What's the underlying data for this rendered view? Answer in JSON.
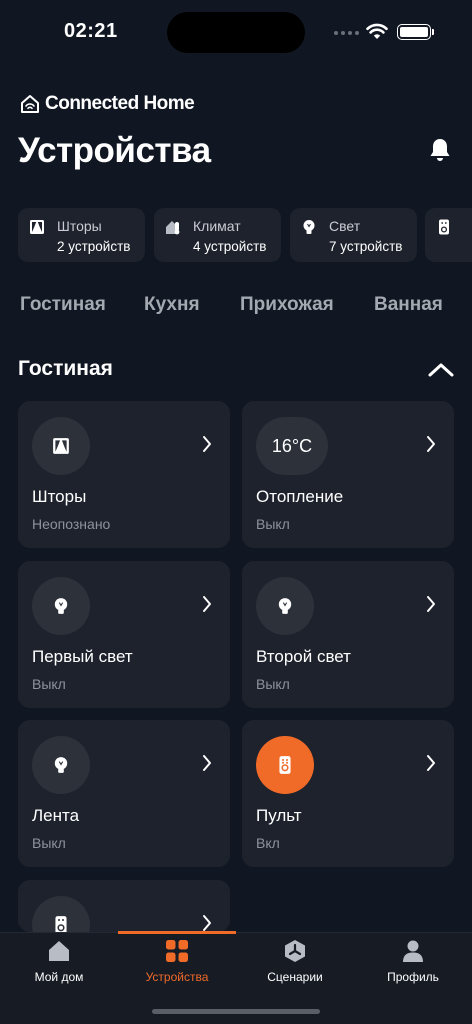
{
  "status_bar": {
    "time": "02:21"
  },
  "brand": {
    "name": "Connected Home"
  },
  "page": {
    "title": "Устройства"
  },
  "categories": [
    {
      "icon": "curtains-icon",
      "label": "Шторы",
      "count": "2 устройств"
    },
    {
      "icon": "climate-icon",
      "label": "Климат",
      "count": "4 устройств"
    },
    {
      "icon": "lightbulb-icon",
      "label": "Свет",
      "count": "7 устройств"
    },
    {
      "icon": "remote-icon",
      "label": "",
      "count": ""
    }
  ],
  "rooms": [
    "Гостиная",
    "Кухня",
    "Прихожая",
    "Ванная"
  ],
  "section": {
    "title": "Гостиная",
    "state": "expanded"
  },
  "devices": [
    {
      "name": "Шторы",
      "status": "Неопознано",
      "icon": "curtains-icon",
      "active": false
    },
    {
      "name": "Отопление",
      "status": "Выкл",
      "icon": "temperature-readout",
      "value": "16°C",
      "active": false
    },
    {
      "name": "Первый свет",
      "status": "Выкл",
      "icon": "lightbulb-icon",
      "active": false
    },
    {
      "name": "Второй свет",
      "status": "Выкл",
      "icon": "lightbulb-icon",
      "active": false
    },
    {
      "name": "Лента",
      "status": "Выкл",
      "icon": "lightbulb-icon",
      "active": false
    },
    {
      "name": "Пульт",
      "status": "Вкл",
      "icon": "remote-icon",
      "active": true
    },
    {
      "name": "",
      "status": "",
      "icon": "remote-icon",
      "active": false
    }
  ],
  "tab_bar": {
    "items": [
      {
        "label": "Мой дом",
        "icon": "home-icon"
      },
      {
        "label": "Устройства",
        "icon": "grid-icon",
        "selected": true
      },
      {
        "label": "Сценарии",
        "icon": "scenarios-icon"
      },
      {
        "label": "Профиль",
        "icon": "profile-icon"
      }
    ]
  },
  "colors": {
    "background": "#111722",
    "card": "#1d222c",
    "accent": "#f06a28",
    "muted_text": "#8e929a"
  }
}
